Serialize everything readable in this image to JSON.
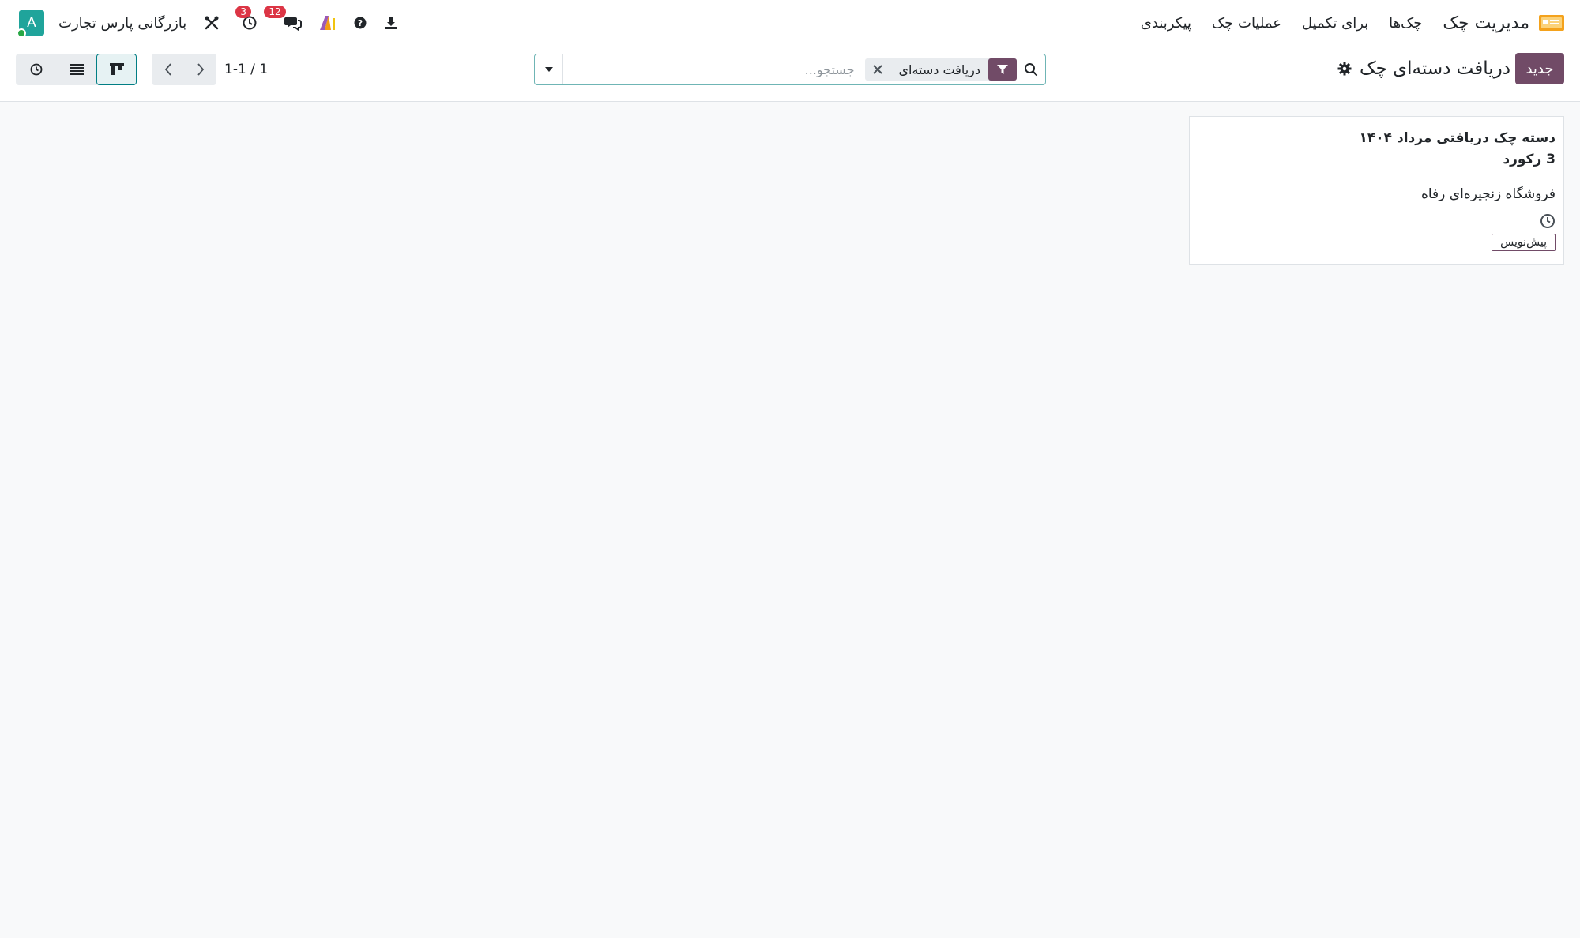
{
  "navbar": {
    "app_title": "مدیریت چک",
    "menu": [
      "چک‌ها",
      "برای تکمیل",
      "عملیات چک",
      "پیکربندی"
    ],
    "company": "بازرگانی پارس تجارت",
    "avatar_letter": "A",
    "activity_count": "3",
    "message_count": "12"
  },
  "control_panel": {
    "new_button": "جدید",
    "breadcrumb_title": "دریافت دسته‌ای چک",
    "search": {
      "placeholder": "جستجو...",
      "facet_label": "دریافت دسته‌ای"
    },
    "pager": "1-1 / 1",
    "views": [
      "kanban",
      "list",
      "activity"
    ],
    "active_view": "kanban"
  },
  "records": [
    {
      "title": "دسته چک دریافتی مرداد ۱۴۰۴",
      "count": "3 رکورد",
      "partner": "فروشگاه زنجیره‌ای رفاه",
      "status": "پیش‌نویس"
    }
  ],
  "colors": {
    "primary": "#714b67",
    "accent": "#017e84",
    "avatar": "#1fa49b",
    "badge": "#dc3545"
  }
}
